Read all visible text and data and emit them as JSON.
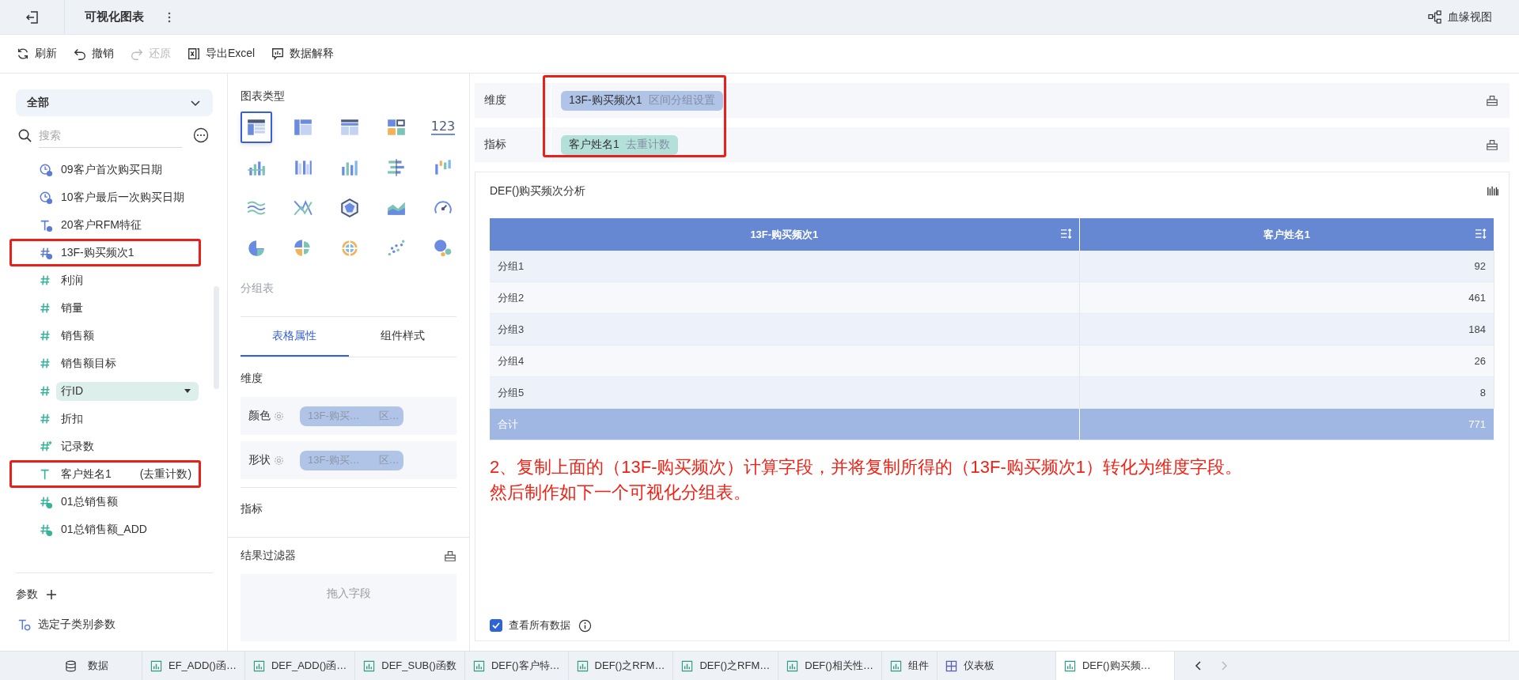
{
  "header": {
    "title": "可视化图表",
    "lineage": "血缘视图"
  },
  "toolbar": [
    {
      "kind": "refresh",
      "label": "刷新",
      "disabled": false
    },
    {
      "kind": "undo",
      "label": "撤销",
      "disabled": false
    },
    {
      "kind": "redo",
      "label": "还原",
      "disabled": true
    },
    {
      "kind": "excel",
      "label": "导出Excel",
      "disabled": false
    },
    {
      "kind": "explain",
      "label": "数据解释",
      "disabled": false
    }
  ],
  "sidebar": {
    "scope": "全部",
    "search_placeholder": "搜索",
    "items": [
      {
        "kind": "date-calc",
        "color": "#5b7bd5",
        "label": "09客户首次购买日期",
        "selected": false,
        "annotated": false
      },
      {
        "kind": "date-calc",
        "color": "#5b7bd5",
        "label": "10客户最后一次购买日期",
        "selected": false,
        "annotated": false
      },
      {
        "kind": "text-calc",
        "color": "#5b7bd5",
        "label": "20客户RFM特征",
        "selected": false,
        "annotated": false
      },
      {
        "kind": "number-calc",
        "color": "#5b7bd5",
        "label": "13F-购买频次1",
        "selected": false,
        "annotated": true
      },
      {
        "kind": "number",
        "color": "#36b39a",
        "label": "利润",
        "selected": false,
        "annotated": false
      },
      {
        "kind": "number",
        "color": "#36b39a",
        "label": "销量",
        "selected": false,
        "annotated": false
      },
      {
        "kind": "number",
        "color": "#36b39a",
        "label": "销售额",
        "selected": false,
        "annotated": false
      },
      {
        "kind": "number",
        "color": "#36b39a",
        "label": "销售额目标",
        "selected": false,
        "annotated": false
      },
      {
        "kind": "number",
        "color": "#36b39a",
        "label": "行ID",
        "selected": true,
        "annotated": false
      },
      {
        "kind": "number",
        "color": "#36b39a",
        "label": "折扣",
        "selected": false,
        "annotated": false
      },
      {
        "kind": "count",
        "color": "#36b39a",
        "label": "记录数",
        "selected": false,
        "annotated": false
      },
      {
        "kind": "text",
        "color": "#36b39a",
        "label": "客户姓名1",
        "suffix": "(去重计数)",
        "selected": false,
        "annotated": true
      },
      {
        "kind": "number-calc",
        "color": "#36b39a",
        "label": "01总销售额",
        "selected": false,
        "annotated": false
      },
      {
        "kind": "number-calc",
        "color": "#36b39a",
        "label": "01总销售额_ADD",
        "selected": false,
        "annotated": false
      }
    ],
    "params_label": "参数",
    "params": [
      {
        "label": "选定子类别参数"
      }
    ]
  },
  "chart_panel": {
    "heading": "图表类型",
    "types": [
      {
        "kind": "group-table",
        "selected": true
      },
      {
        "kind": "cross-table",
        "selected": false
      },
      {
        "kind": "detail-table",
        "selected": false
      },
      {
        "kind": "multi-block",
        "selected": false
      },
      {
        "kind": "number",
        "label": "123",
        "selected": false
      },
      {
        "kind": "dot-bar",
        "selected": false
      },
      {
        "kind": "multi-column",
        "selected": false
      },
      {
        "kind": "column",
        "selected": false
      },
      {
        "kind": "center-bar",
        "selected": false
      },
      {
        "kind": "waterfall",
        "selected": false
      },
      {
        "kind": "wave",
        "selected": false
      },
      {
        "kind": "cross-line",
        "selected": false
      },
      {
        "kind": "radar",
        "selected": false
      },
      {
        "kind": "area",
        "selected": false
      },
      {
        "kind": "gauge",
        "selected": false
      },
      {
        "kind": "pie",
        "selected": false
      },
      {
        "kind": "rose",
        "selected": false
      },
      {
        "kind": "ring",
        "selected": false
      },
      {
        "kind": "scatter",
        "selected": false
      },
      {
        "kind": "bubble",
        "selected": false
      }
    ],
    "type_name": "分组表",
    "tabs": [
      {
        "label": "表格属性",
        "selected": true
      },
      {
        "label": "组件样式",
        "selected": false
      }
    ],
    "dimension_heading": "维度",
    "dimension_rows": [
      {
        "label": "颜色",
        "field": "13F-购买…",
        "sub": "区…"
      },
      {
        "label": "形状",
        "field": "13F-购买…",
        "sub": "区…"
      }
    ],
    "measure_heading": "指标",
    "filter": {
      "title": "结果过滤器",
      "placeholder": "拖入字段"
    }
  },
  "fields": {
    "annotated": true,
    "rows": [
      {
        "label": "维度",
        "kind": "dimension",
        "pill": "13F-购买频次1",
        "sub": "区间分组设置"
      },
      {
        "label": "指标",
        "kind": "measure",
        "pill": "客户姓名1",
        "sub": "去重计数"
      }
    ]
  },
  "widget": {
    "title": "DEF()购买频次分析",
    "table": {
      "columns": [
        "13F-购买频次1",
        "客户姓名1"
      ],
      "rows": [
        [
          "分组1",
          "92"
        ],
        [
          "分组2",
          "461"
        ],
        [
          "分组3",
          "184"
        ],
        [
          "分组4",
          "26"
        ],
        [
          "分组5",
          "8"
        ]
      ],
      "total": [
        "合计",
        "771"
      ]
    },
    "annotation": [
      "2、复制上面的（13F-购买频次）计算字段，并将复制所得的（13F-购买频次1）转化为维度字段。",
      "然后制作如下一个可视化分组表。"
    ],
    "show_all": {
      "label": "查看所有数据",
      "checked": true
    }
  },
  "bottom_tabs": [
    {
      "kind": "data",
      "label": "数据",
      "selected": false
    },
    {
      "kind": "chart",
      "label": "EF_ADD()函…",
      "selected": false
    },
    {
      "kind": "chart",
      "label": "DEF_ADD()函…",
      "selected": false
    },
    {
      "kind": "chart",
      "label": "DEF_SUB()函数",
      "selected": false
    },
    {
      "kind": "chart",
      "label": "DEF()客户特…",
      "selected": false
    },
    {
      "kind": "chart",
      "label": "DEF()之RFM…",
      "selected": false
    },
    {
      "kind": "chart",
      "label": "DEF()之RFM…",
      "selected": false
    },
    {
      "kind": "chart",
      "label": "DEF()相关性…",
      "selected": false
    },
    {
      "kind": "chart",
      "label": "组件",
      "selected": false
    },
    {
      "kind": "dashboard",
      "label": "仪表板",
      "selected": false
    },
    {
      "kind": "chart",
      "label": "DEF()购买频…",
      "selected": true
    }
  ]
}
